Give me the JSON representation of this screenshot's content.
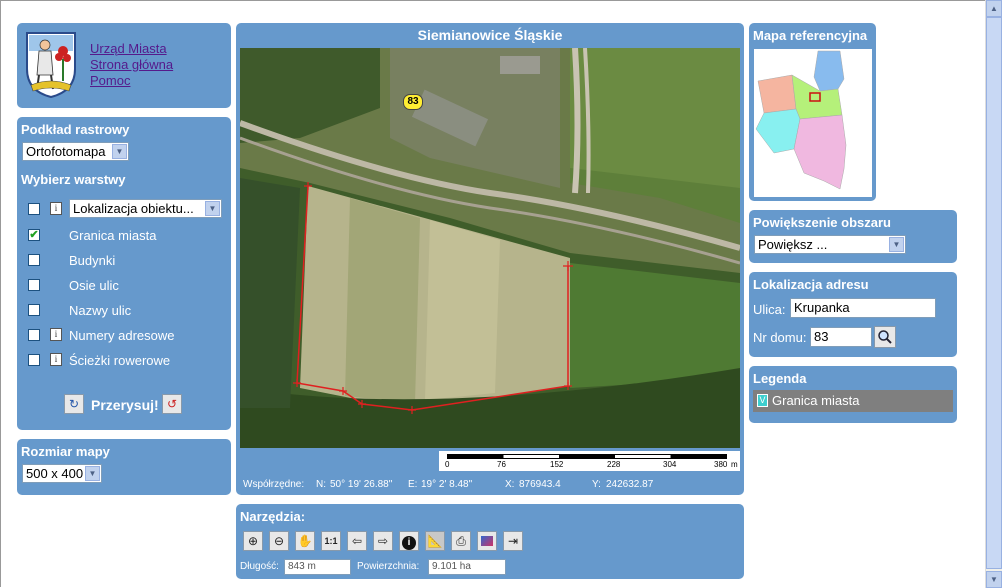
{
  "city_title": "Siemianowice Śląskie",
  "links": [
    "Urząd Miasta",
    "Strona główna",
    "Pomoc"
  ],
  "raster": {
    "heading": "Podkład rastrowy",
    "selected": "Ortofotomapa"
  },
  "layers": {
    "heading": "Wybierz warstwy",
    "dropdown_value": "Lokalizacja obiektu...",
    "items": [
      {
        "label": "Granica miasta",
        "checked": true,
        "has_info": false
      },
      {
        "label": "Budynki",
        "checked": false,
        "has_info": false
      },
      {
        "label": "Osie ulic",
        "checked": false,
        "has_info": false
      },
      {
        "label": "Nazwy ulic",
        "checked": false,
        "has_info": false
      },
      {
        "label": "Numery adresowe",
        "checked": false,
        "has_info": true
      },
      {
        "label": "Ścieżki rowerowe",
        "checked": false,
        "has_info": true
      }
    ],
    "redraw_label": "Przerysuj!"
  },
  "map_size": {
    "heading": "Rozmiar mapy",
    "selected": "500 x 400"
  },
  "map": {
    "address_marker": "83",
    "scale_labels": [
      "0",
      "76",
      "152",
      "228",
      "304",
      "380"
    ],
    "scale_unit": "m"
  },
  "coords": {
    "label": "Współrzędne:",
    "n_label": "N:",
    "n_value": "50° 19' 26.88\"",
    "e_label": "E:",
    "e_value": "19° 2' 8.48\"",
    "x_label": "X:",
    "x_value": "876943.4",
    "y_label": "Y:",
    "y_value": "242632.87"
  },
  "tools": {
    "heading": "Narzędzia:",
    "buttons": [
      "zoom-in-icon",
      "zoom-out-icon",
      "pan-hand-icon",
      "scale-1-1-icon",
      "back-arrow-icon",
      "forward-arrow-icon",
      "info-icon",
      "measure-icon",
      "print-icon",
      "export-image-icon",
      "export-pdf-icon"
    ],
    "scale_text": "1:1",
    "length_label": "Długość:",
    "length_value": "843 m",
    "area_label": "Powierzchnia:",
    "area_value": "9.101 ha"
  },
  "reference": {
    "heading": "Mapa referencyjna"
  },
  "zoom_area": {
    "heading": "Powiększenie obszaru",
    "selected": "Powiększ ..."
  },
  "address": {
    "heading": "Lokalizacja adresu",
    "street_label": "Ulica:",
    "street_value": "Krupanka",
    "number_label": "Nr domu:",
    "number_value": "83"
  },
  "legend": {
    "heading": "Legenda",
    "items": [
      "Granica miasta"
    ]
  },
  "colors": {
    "panel": "#6699cc",
    "boundary": "#e02020",
    "link": "#551a8b"
  }
}
